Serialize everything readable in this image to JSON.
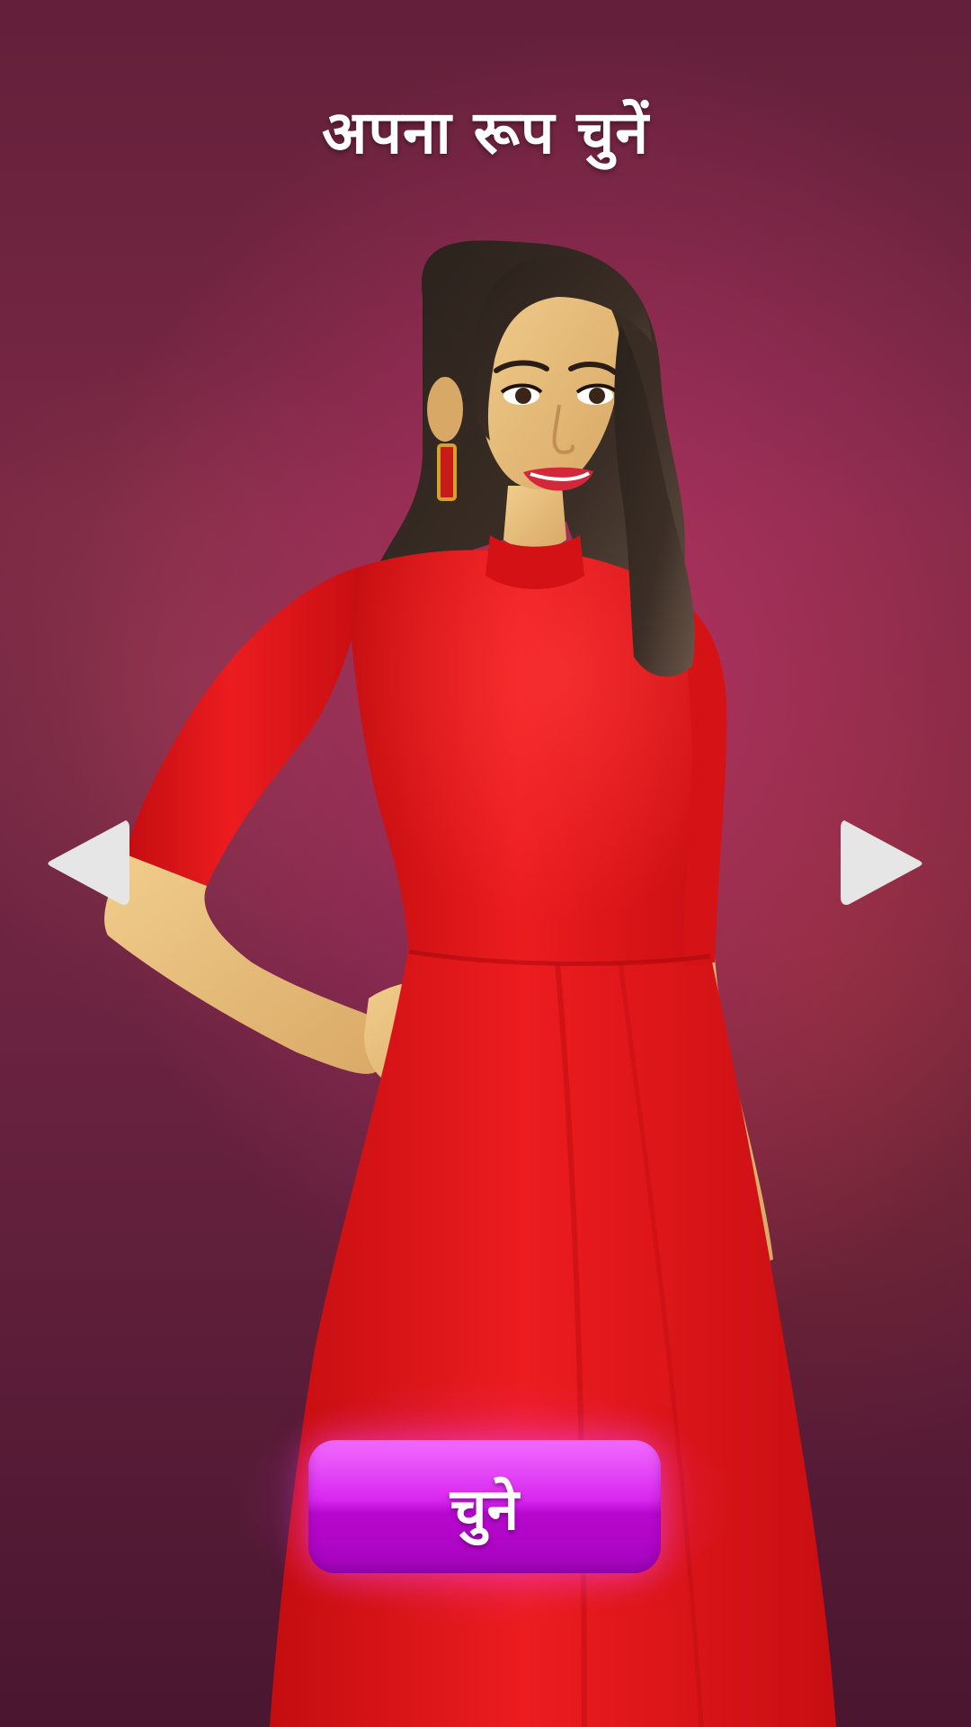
{
  "screen": {
    "title": "अपना रूप चुनें"
  },
  "avatar": {
    "description_icon": "avatar-woman-red-dress",
    "dress_color": "#e8161a"
  },
  "nav": {
    "prev_icon": "triangle-left-icon",
    "next_icon": "triangle-right-icon",
    "arrow_color": "#e6e6e6"
  },
  "select_button": {
    "label": "चुने",
    "color": "#c513e0"
  }
}
